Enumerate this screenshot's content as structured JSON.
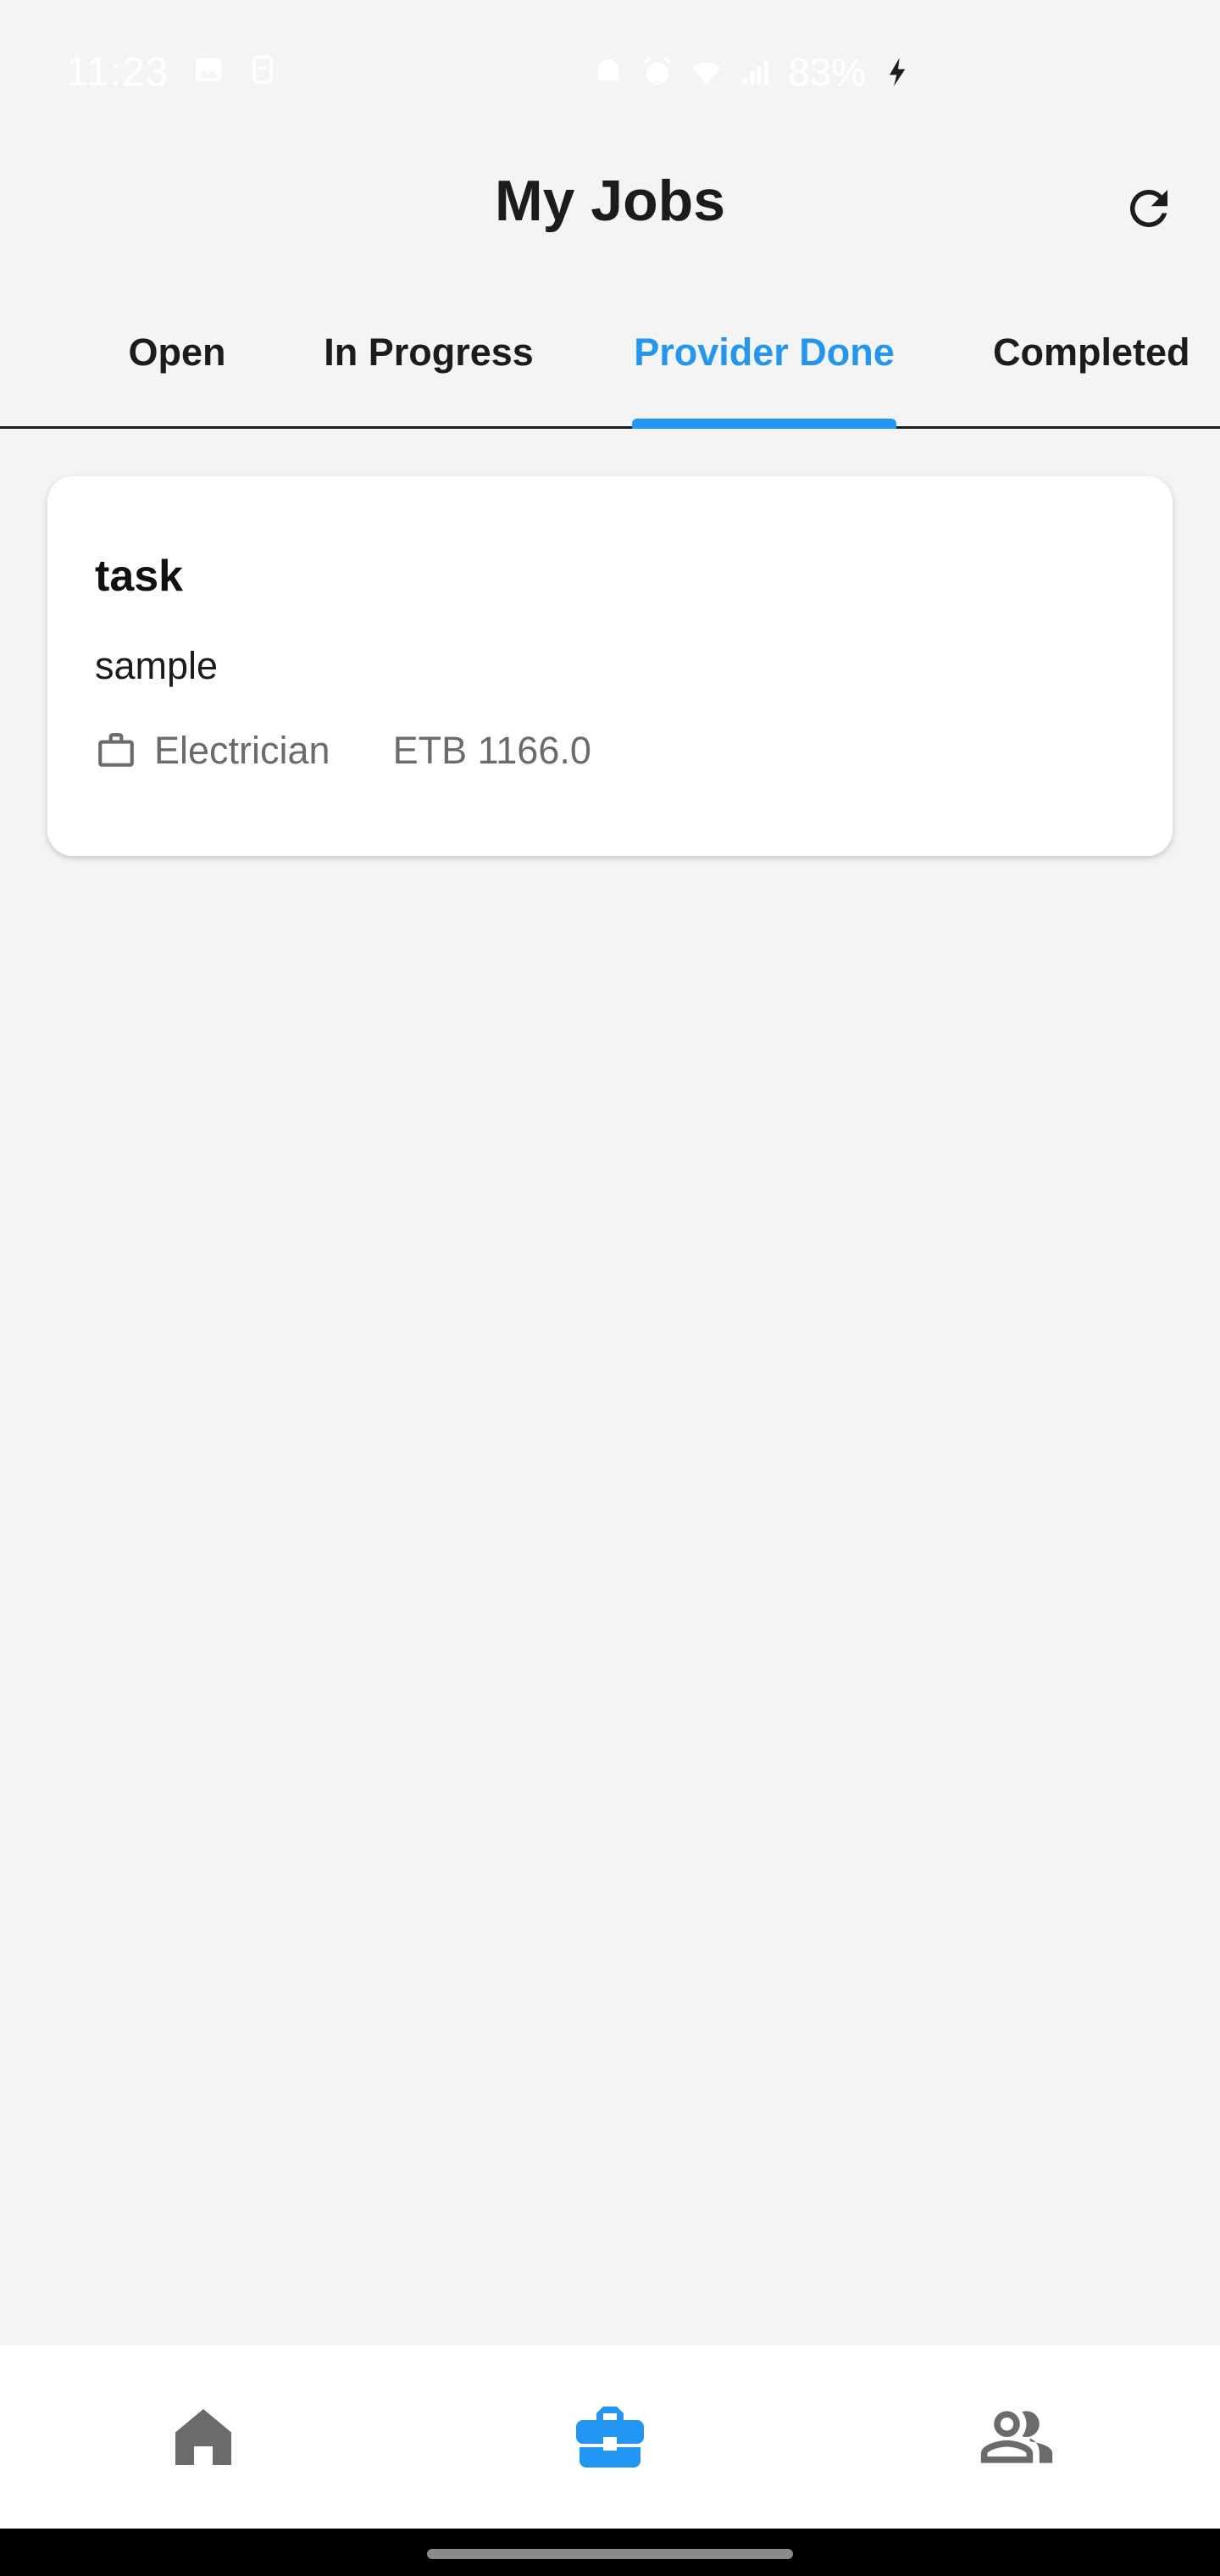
{
  "status_bar": {
    "time": "11:23",
    "battery": "83%"
  },
  "app_bar": {
    "title": "My Jobs",
    "refresh_icon": "refresh-icon"
  },
  "tabs": [
    {
      "label": "Open",
      "active": false
    },
    {
      "label": "In Progress",
      "active": false
    },
    {
      "label": "Provider Done",
      "active": true
    },
    {
      "label": "Completed",
      "active": false
    }
  ],
  "jobs": [
    {
      "title": "task",
      "description": "sample",
      "category": "Electrician",
      "price": "ETB 1166.0",
      "category_icon": "briefcase-icon"
    }
  ],
  "bottom_nav": {
    "items": [
      {
        "icon": "home-icon",
        "active": false
      },
      {
        "icon": "briefcase-icon",
        "active": true
      },
      {
        "icon": "people-icon",
        "active": false
      }
    ]
  },
  "colors": {
    "accent": "#2196f3",
    "background": "#f4f4f4",
    "inactive_icon": "#6b6b6b"
  }
}
